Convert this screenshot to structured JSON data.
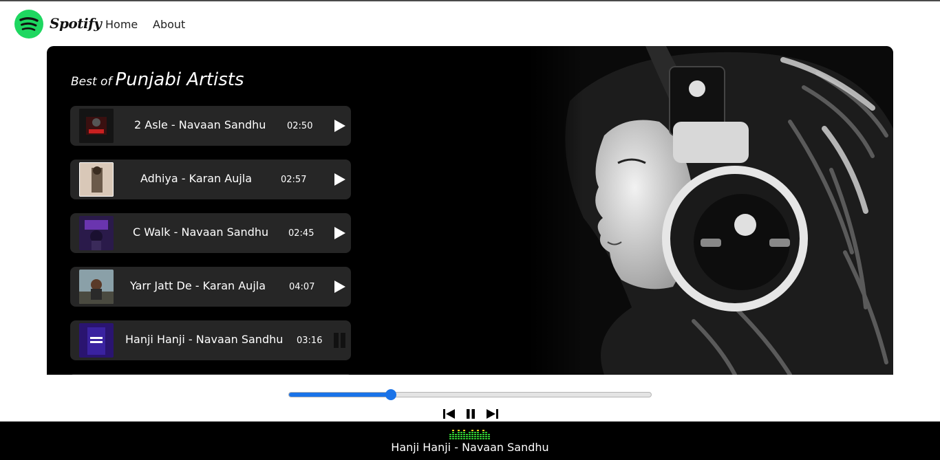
{
  "nav": {
    "brand": "Spotify",
    "links": [
      "Home",
      "About"
    ],
    "logo_icon": "spotify-logo-icon",
    "accent": "#1ed760"
  },
  "hero": {
    "heading_small": "Best of",
    "heading_big": "Punjabi Artists"
  },
  "songs": [
    {
      "title": "2 Asle - Navaan Sandhu",
      "duration": "02:50",
      "state": "play"
    },
    {
      "title": "Adhiya - Karan Aujla",
      "duration": "02:57",
      "state": "play"
    },
    {
      "title": "C Walk - Navaan Sandhu",
      "duration": "02:45",
      "state": "play"
    },
    {
      "title": "Yarr Jatt De - Karan Aujla",
      "duration": "04:07",
      "state": "play"
    },
    {
      "title": "Hanji Hanji - Navaan Sandhu",
      "duration": "03:16",
      "state": "pause"
    }
  ],
  "player": {
    "progress": 0.28,
    "now_playing": "Hanji Hanji - Navaan Sandhu",
    "controls": [
      "previous-icon",
      "pause-icon",
      "next-icon"
    ],
    "progress_color": "#1a73e8"
  }
}
